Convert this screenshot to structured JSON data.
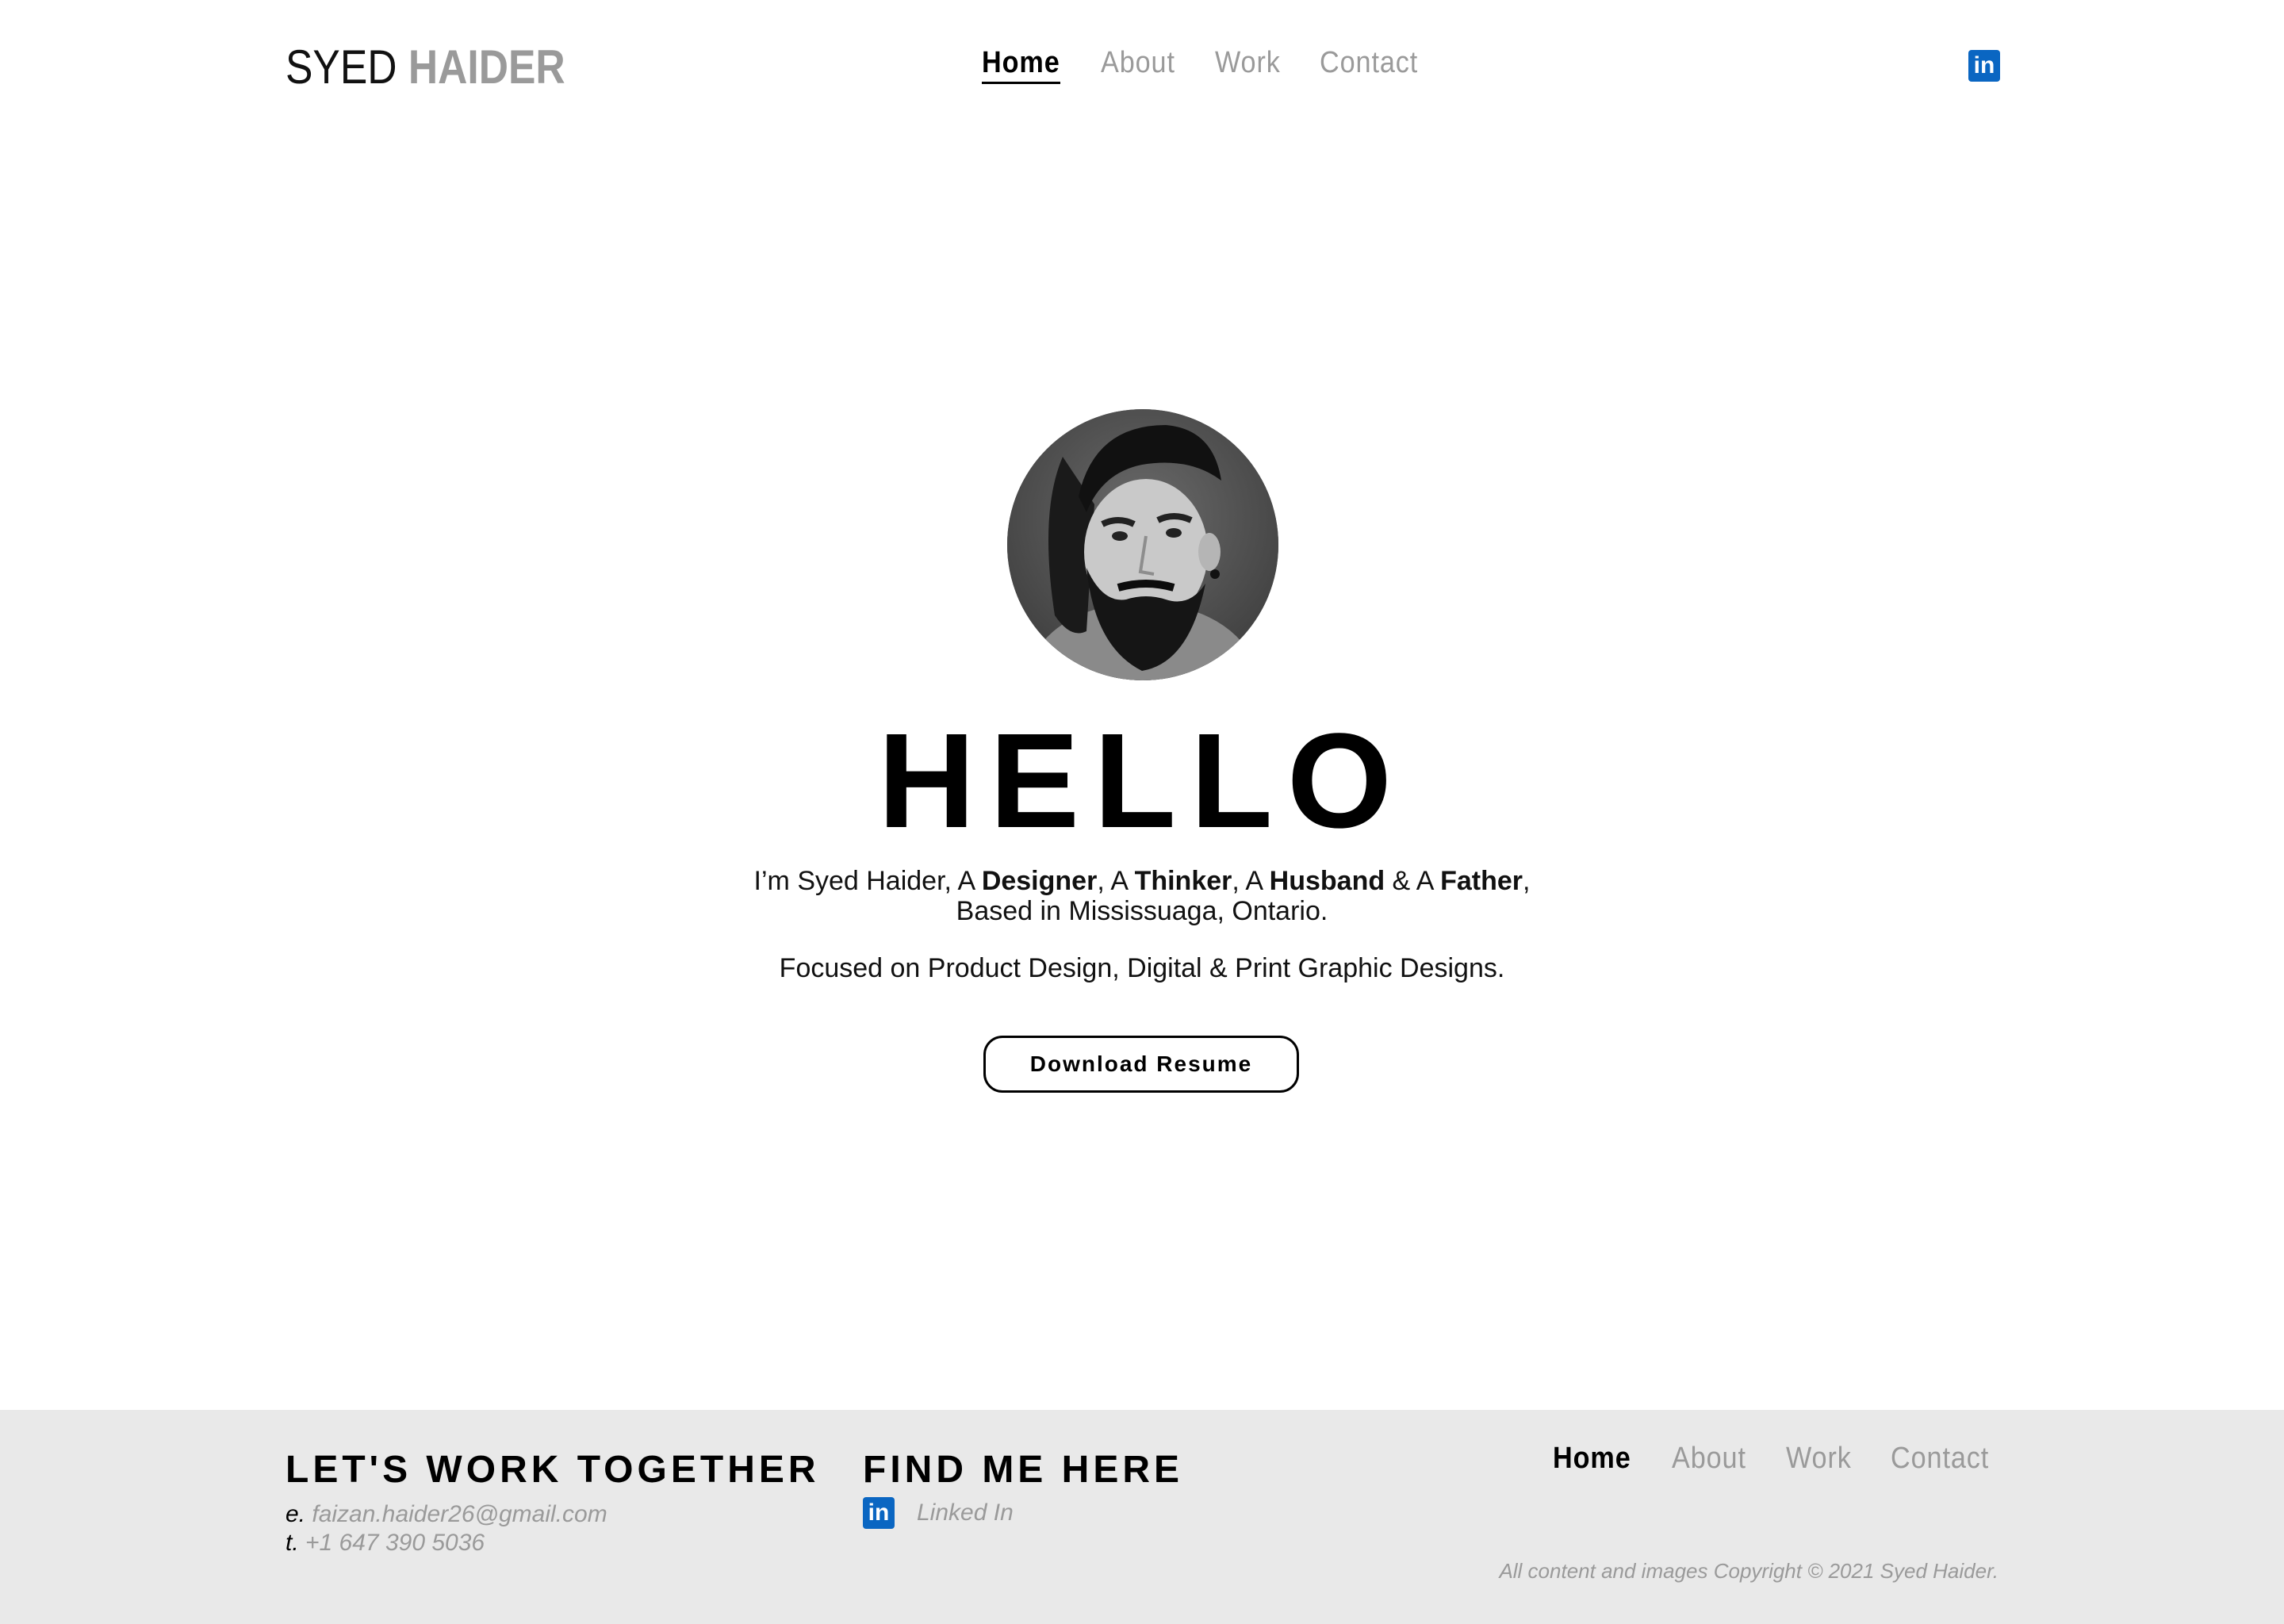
{
  "header": {
    "logo_first": "SYED",
    "logo_last": "HAIDER",
    "nav": [
      {
        "label": "Home"
      },
      {
        "label": "About"
      },
      {
        "label": "Work"
      },
      {
        "label": "Contact"
      }
    ],
    "linkedin_icon": "linkedin-icon",
    "linkedin_glyph": "in"
  },
  "hero": {
    "heading": "HELLO",
    "intro_1": "I’m Syed Haider, A ",
    "role_1": "Designer",
    "sep_1": ", A ",
    "role_2": "Thinker",
    "sep_2": ", A ",
    "role_3": "Husband",
    "sep_3": " & A ",
    "role_4": "Father",
    "sep_4": ",",
    "location": "Based in Mississuaga, Ontario.",
    "focus": "Focused on Product Design, Digital & Print Graphic Designs.",
    "resume_button": "Download Resume"
  },
  "footer": {
    "work_heading": "LET'S WORK TOGETHER",
    "email_key": "e.",
    "email": "faizan.haider26@gmail.com",
    "phone_key": "t.",
    "phone": "+1 647 390 5036",
    "find_heading": "FIND ME HERE",
    "linkedin_label": "Linked In",
    "nav": [
      {
        "label": "Home"
      },
      {
        "label": "About"
      },
      {
        "label": "Work"
      },
      {
        "label": "Contact"
      }
    ],
    "copyright": "All content and images Copyright © 2021 Syed Haider."
  },
  "colors": {
    "accent_linkedin": "#0a66c2",
    "muted_text": "#9a9a9a",
    "footer_bg": "#e9e9e9"
  }
}
